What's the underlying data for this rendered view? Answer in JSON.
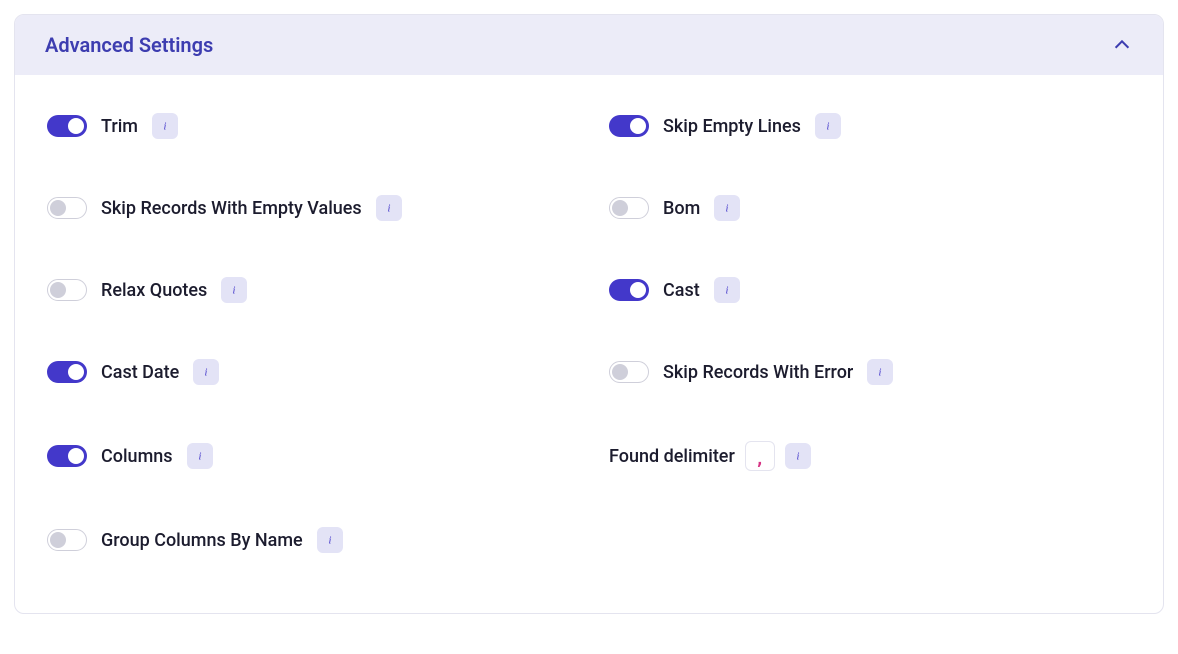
{
  "panel": {
    "title": "Advanced Settings"
  },
  "settings": {
    "trim": {
      "label": "Trim",
      "on": true
    },
    "skip_empty_lines": {
      "label": "Skip Empty Lines",
      "on": true
    },
    "skip_records_empty": {
      "label": "Skip Records With Empty Values",
      "on": false
    },
    "bom": {
      "label": "Bom",
      "on": false
    },
    "relax_quotes": {
      "label": "Relax Quotes",
      "on": false
    },
    "cast": {
      "label": "Cast",
      "on": true
    },
    "cast_date": {
      "label": "Cast Date",
      "on": true
    },
    "skip_records_error": {
      "label": "Skip Records With Error",
      "on": false
    },
    "columns": {
      "label": "Columns",
      "on": true
    },
    "group_columns_by_name": {
      "label": "Group Columns By Name",
      "on": false
    }
  },
  "delimiter": {
    "label": "Found delimiter",
    "value": ","
  }
}
